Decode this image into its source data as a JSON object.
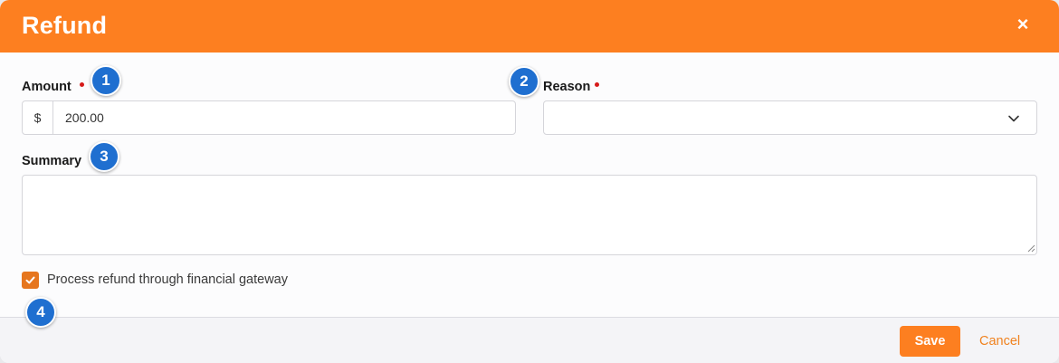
{
  "dialog": {
    "title": "Refund",
    "close_label": "×"
  },
  "amount": {
    "label": "Amount",
    "prefix": "$",
    "value": "200.00",
    "required": true
  },
  "reason": {
    "label": "Reason",
    "selected": "",
    "required": true
  },
  "summary": {
    "label": "Summary",
    "value": ""
  },
  "gateway_option": {
    "label": "Process refund through financial gateway",
    "checked": true
  },
  "badges": [
    "1",
    "2",
    "3",
    "4"
  ],
  "footer": {
    "save_label": "Save",
    "cancel_label": "Cancel"
  },
  "colors": {
    "header": "#fd7f20",
    "badge": "#1f6fd0",
    "required": "#d61a1a",
    "checkbox": "#e6761d"
  }
}
